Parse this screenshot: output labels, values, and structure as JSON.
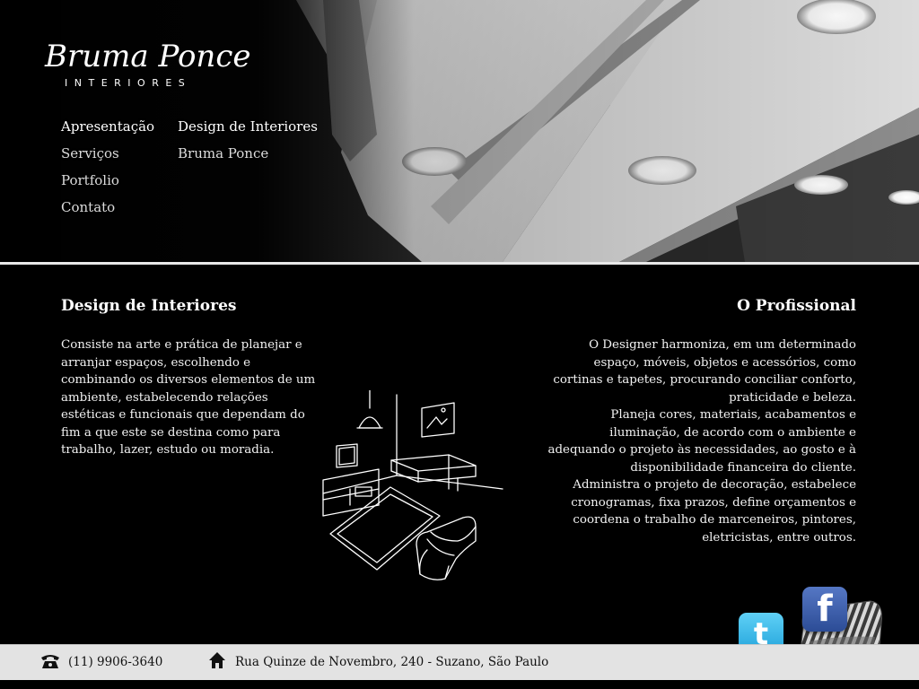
{
  "logo": {
    "script": "Bruma Ponce",
    "subtitle": "INTERIORES"
  },
  "nav": {
    "col1": [
      "Apresentação",
      "Serviços",
      "Portfolio",
      "Contato"
    ],
    "col2": [
      "Design de Interiores",
      "Bruma Ponce"
    ]
  },
  "left": {
    "title": "Design de Interiores",
    "body": "Consiste na arte e prática de planejar e arranjar espaços, escolhendo e combinando os diversos elementos de um ambiente, estabelecendo relações estéticas e funcionais que dependam do fim a que este se destina como para trabalho, lazer, estudo ou moradia."
  },
  "right": {
    "title": "O Profissional",
    "paragraphs": [
      "O Designer harmoniza, em um determinado espaço, móveis, objetos e acessórios, como cortinas e tapetes, procurando conciliar conforto, praticidade e beleza.",
      "Planeja cores, materiais, acabamentos e iluminação, de acordo com o ambiente e adequando o projeto às necessidades, ao gosto e à disponibilidade financeira do cliente.",
      "Administra o projeto de decoração, estabelece cronogramas, fixa prazos, define orçamentos e coordena o trabalho de marceneiros, pintores, eletricistas, entre outros."
    ]
  },
  "social": {
    "twitter_icon": "twitter-icon",
    "facebook_icon": "facebook-icon"
  },
  "footer": {
    "phone": "(11) 9906-3640",
    "address": "Rua Quinze de Novembro, 240 - Suzano, São Paulo",
    "phone_icon": "phone-icon",
    "home_icon": "home-icon"
  },
  "colors": {
    "background": "#000000",
    "footer_bg": "#e3e3e3",
    "twitter": "#1c9fd8",
    "facebook": "#3b5998"
  }
}
